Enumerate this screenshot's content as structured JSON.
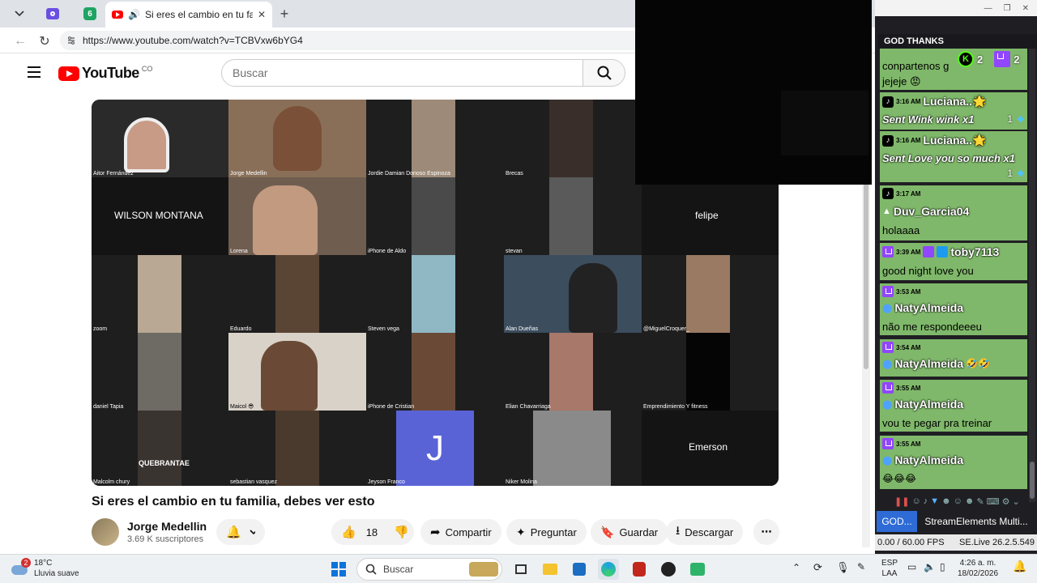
{
  "browser": {
    "tab_title": "Si eres el cambio en tu familia",
    "pinned_tab_badge": "6",
    "url": "https://www.youtube.com/watch?v=TCBVxw6bYG4"
  },
  "youtube": {
    "logo_text": "YouTube",
    "country": "CO",
    "search_placeholder": "Buscar",
    "video_title": "Si eres el cambio en tu familia, debes ver esto",
    "channel_name": "Jorge Medellin",
    "subscribers": "3.69 K suscriptores",
    "likes": "18",
    "share_label": "Compartir",
    "ask_label": "Preguntar",
    "save_label": "Guardar",
    "download_label": "Descargar"
  },
  "meeting": {
    "participants": [
      "Aitor Fernández",
      "Jorge Medellin",
      "Jordie Damian Donoso Espinoza",
      "Brecas",
      "Lorena",
      "iPhone de Aldo",
      "stevan",
      "zoom",
      "Eduardo",
      "Steven vega",
      "Alan Dueñas",
      "@MiguelCroquer_",
      "daniel Tapia",
      "Maicol 😎",
      "iPhone de Cristian",
      "Elian Chavarriaga",
      "Emprendimiento Y fitness",
      "Malcolm chury",
      "sebastian vasquez",
      "Jeyson Franco",
      "Niker Molina"
    ],
    "big_names": [
      "WILSON MONTANA",
      "felipe",
      "Emerson"
    ],
    "avatar_letter": "J",
    "poster_text": "QUEBRANTAE"
  },
  "chat": {
    "header": "GOD THANKS",
    "counts": {
      "kick": "2",
      "twitch": "2"
    },
    "messages": [
      {
        "time": "",
        "user": "",
        "text": "conpartenos g"
      },
      {
        "time": "",
        "user": "",
        "text": "jejeje 😡"
      },
      {
        "time": "3:16 AM",
        "user": "Luciana..🌟",
        "text": "Sent Wink wink x1",
        "qty": "1"
      },
      {
        "time": "3:16 AM",
        "user": "Luciana..🌟",
        "text": "Sent Love you so much x1",
        "qty": "1"
      },
      {
        "time": "3:17 AM",
        "user": "Duv_Garcia04",
        "text": "holaaaa"
      },
      {
        "time": "3:39 AM",
        "user": "toby7113",
        "text": "good night love you"
      },
      {
        "time": "3:53 AM",
        "user": "NatyAlmeida",
        "text": "não me respondeeeu"
      },
      {
        "time": "3:54 AM",
        "user": "NatyAlmeida",
        "text": "🤣🤣"
      },
      {
        "time": "3:55 AM",
        "user": "NatyAlmeida",
        "text": "vou te pegar pra treinar"
      },
      {
        "time": "3:55 AM",
        "user": "NatyAlmeida",
        "text": "😂😂😂"
      }
    ],
    "tab1": "GOD...",
    "tab2": "StreamElements Multi...",
    "fps": "0.00 / 60.00 FPS",
    "version": "SE.Live 26.2.5.549"
  },
  "taskbar": {
    "temperature": "18°C",
    "weather": "Lluvia suave",
    "weather_badge": "2",
    "search_placeholder": "Buscar",
    "lang1": "ESP",
    "lang2": "LAA",
    "time": "4:26 a. m.",
    "date": "18/02/2026"
  },
  "colors": {
    "chat_message_bg": "#7fb86a",
    "youtube_red": "#ff0000",
    "twitch_purple": "#9146ff",
    "kick_green": "#53fc18"
  }
}
